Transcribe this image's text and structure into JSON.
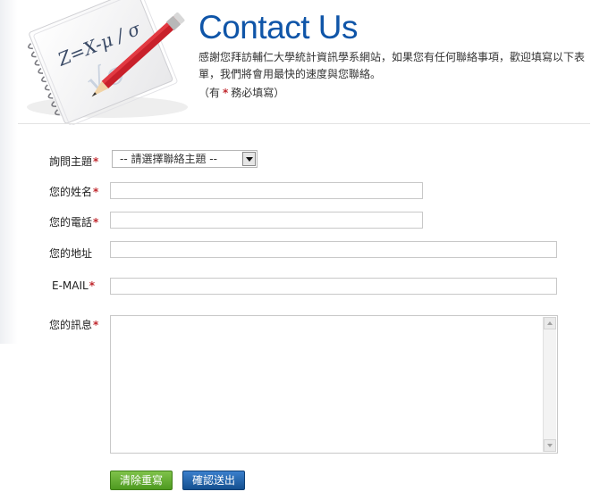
{
  "header": {
    "title": "Contact Us",
    "intro": "感謝您拜訪輔仁大學統計資訊學系網站，如果您有任何聯絡事項，歡迎填寫以下表單，我們將會用最快的速度與您聯絡。",
    "required_prefix": "（有",
    "required_star": "*",
    "required_suffix": "務必填寫）",
    "illustration_text": "Z=X-μ / σ"
  },
  "form": {
    "subject": {
      "label": "詢問主題",
      "required": "*",
      "selected": "-- 請選擇聯絡主題 --"
    },
    "name": {
      "label": "您的姓名",
      "required": "*",
      "value": ""
    },
    "phone": {
      "label": "您的電話",
      "required": "*",
      "value": ""
    },
    "address": {
      "label": "您的地址",
      "value": ""
    },
    "email": {
      "label": "E-MAIL",
      "required": "*",
      "value": ""
    },
    "message": {
      "label": "您的訊息",
      "required": "*",
      "value": ""
    }
  },
  "buttons": {
    "reset": "清除重寫",
    "submit": "確認送出"
  },
  "colors": {
    "title": "#0f55a8",
    "required": "#c0282e",
    "reset_button": "#5aa82a",
    "submit_button": "#1d5fa6"
  }
}
